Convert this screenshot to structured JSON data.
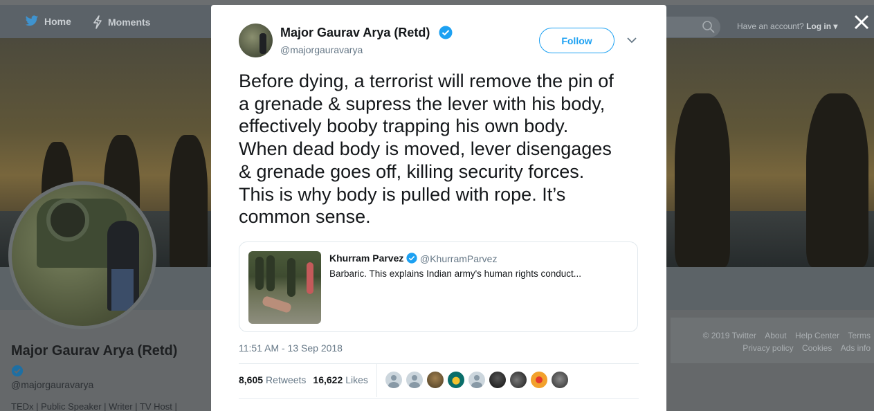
{
  "nav": {
    "home_label": "Home",
    "moments_label": "Moments",
    "account_prefix": "Have an account?",
    "login_label": "Log in",
    "login_caret": "▾"
  },
  "profile": {
    "name": "Major Gaurav Arya (Retd)",
    "handle": "@majorgauravarya",
    "bio": "TEDx | Public Speaker | Writer | TV Host |"
  },
  "footer": {
    "links_row1": [
      "© 2019 Twitter",
      "About",
      "Help Center",
      "Terms"
    ],
    "links_row2": [
      "Privacy policy",
      "Cookies",
      "Ads info"
    ]
  },
  "tweet": {
    "author_name": "Major Gaurav Arya (Retd)",
    "author_handle": "@majorgauravarya",
    "follow_label": "Follow",
    "text": "Before dying, a terrorist will remove the pin of\na grenade & supress the lever with his body,\neffectively booby trapping his own body.\nWhen dead body is moved, lever disengages\n& grenade goes off, killing security forces.\nThis is why body is pulled with rope. It’s\ncommon sense.",
    "quoted": {
      "name": "Khurram Parvez",
      "handle": "@KhurramParvez",
      "text": "Barbaric. This explains Indian army's human rights conduct..."
    },
    "timestamp": "11:51 AM - 13 Sep 2018",
    "retweets_count": "8,605",
    "retweets_label": "Retweets",
    "likes_count": "16,622",
    "likes_label": "Likes"
  },
  "colors": {
    "accent": "#1da1f2",
    "text_primary": "#14171a",
    "text_secondary": "#657786"
  },
  "icons": [
    "bird-icon",
    "lightning-icon",
    "search-icon",
    "verified-icon",
    "chevron-down-icon",
    "close-icon"
  ]
}
